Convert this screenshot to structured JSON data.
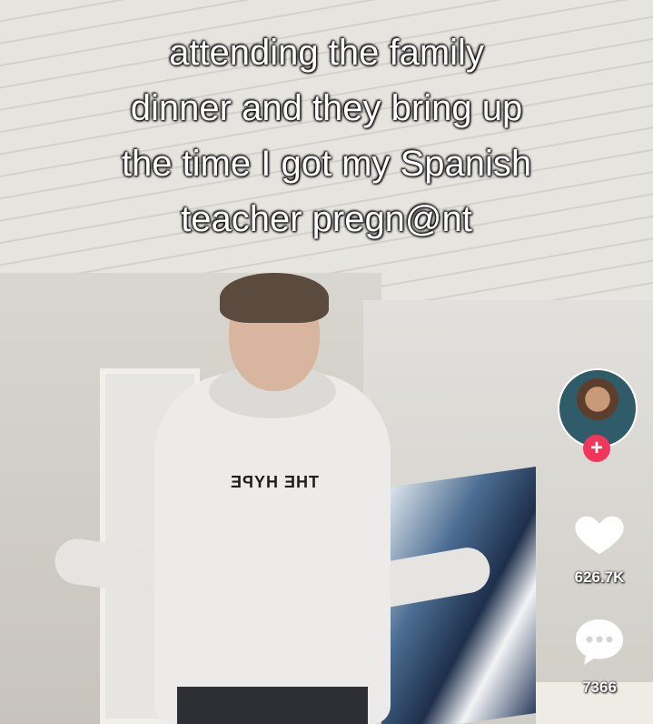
{
  "caption": {
    "line1": "attending the family",
    "line2": "dinner and they bring up",
    "line3": "the time I got my Spanish",
    "line4": "teacher pregn@nt"
  },
  "sidebar": {
    "avatar_icon": "profile-avatar-icon",
    "follow_icon": "plus-icon",
    "follow_label": "+",
    "like_icon": "heart-icon",
    "like_count": "626.7K",
    "comment_icon": "comment-bubble-icon",
    "comment_count": "7366"
  },
  "video": {
    "shirt_text": "THE HYPE"
  },
  "colors": {
    "accent": "#f2355a",
    "caption_text": "#ffffff"
  }
}
